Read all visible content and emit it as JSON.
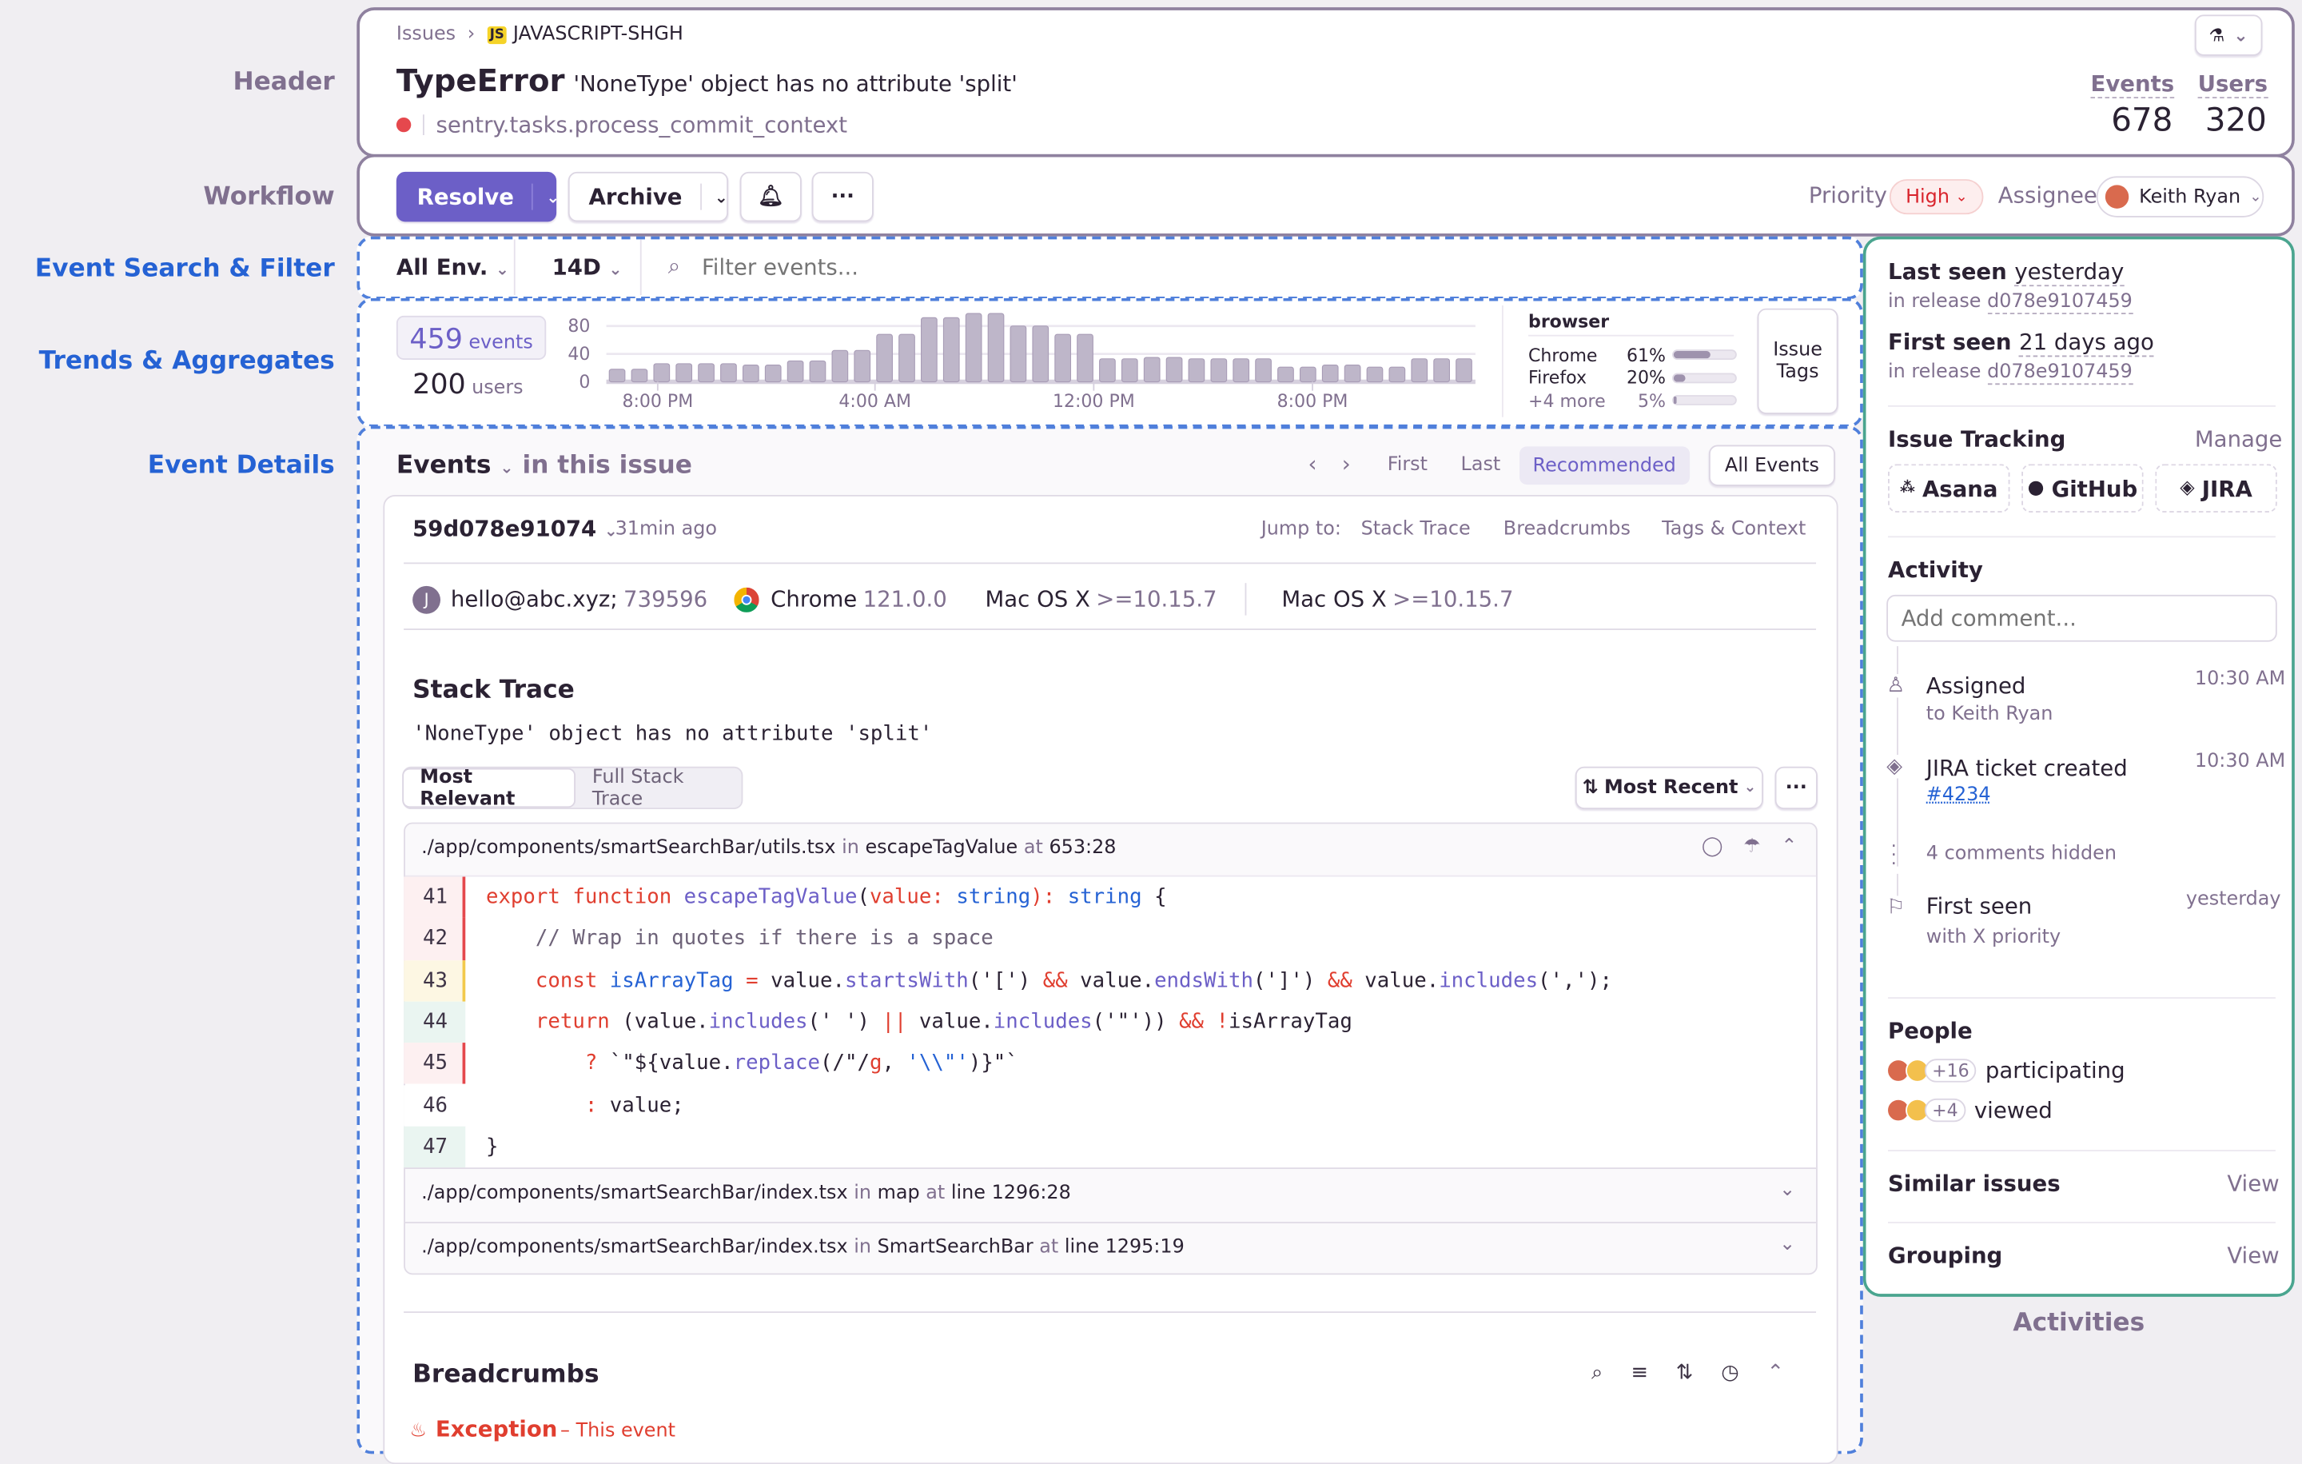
{
  "annotations": {
    "header": "Header",
    "workflow": "Workflow",
    "search": "Event Search & Filter",
    "trends": "Trends & Aggregates",
    "details": "Event Details",
    "activities": "Activities"
  },
  "colors": {
    "accent": "#6c5fc7",
    "annotation_blue": "#2562d4",
    "annotation_gray": "#80708f",
    "sidebar_border": "#4aa58f",
    "error": "#e03e2f"
  },
  "header": {
    "breadcrumb": [
      "Issues",
      "JAVASCRIPT-SHGH"
    ],
    "platform_badge": "JS",
    "error_type": "TypeError",
    "error_message": "'NoneType' object has no attribute 'split'",
    "culprit": "sentry.tasks.process_commit_context",
    "events_label": "Events",
    "events_value": "678",
    "users_label": "Users",
    "users_value": "320",
    "flask_icon": "flask-icon"
  },
  "workflow": {
    "resolve": "Resolve",
    "archive": "Archive",
    "more": "···",
    "priority_label": "Priority",
    "priority_value": "High",
    "assignee_label": "Assignee",
    "assignee_value": "Keith Ryan"
  },
  "filter": {
    "environment": "All Env.",
    "period": "14D",
    "search_placeholder": "Filter events..."
  },
  "trends": {
    "events_count": "459",
    "events_label": "events",
    "users_count": "200",
    "users_label": "users",
    "tag_title": "browser",
    "tags": [
      {
        "name": "Chrome",
        "pct": "61%",
        "value": 61
      },
      {
        "name": "Firefox",
        "pct": "20%",
        "value": 20
      },
      {
        "name": "+4 more",
        "pct": "5%",
        "value": 5
      }
    ],
    "issue_tags_button": "Issue Tags"
  },
  "chart_data": {
    "type": "bar",
    "yticks": [
      "0",
      "40",
      "80"
    ],
    "ylim": [
      0,
      100
    ],
    "xtick_labels": [
      "8:00 PM",
      "4:00 AM",
      "12:00 PM",
      "8:00 PM"
    ],
    "values": [
      18,
      18,
      26,
      26,
      26,
      26,
      24,
      24,
      30,
      30,
      45,
      45,
      68,
      68,
      92,
      92,
      98,
      98,
      80,
      80,
      68,
      68,
      33,
      33,
      35,
      35,
      33,
      33,
      33,
      33,
      21,
      21,
      24,
      24,
      21,
      21,
      33,
      33,
      33
    ],
    "grid": true
  },
  "events": {
    "title": "Events",
    "subtitle": "in this issue",
    "nav": [
      "First",
      "Last",
      "Recommended"
    ],
    "all_events": "All Events",
    "event_id": "59d078e91074",
    "event_age": "31min ago",
    "jump_label": "Jump to:",
    "jump_links": [
      "Stack Trace",
      "Breadcrumbs",
      "Tags & Context"
    ],
    "context": {
      "user_initial": "J",
      "user": "hello@abc.xyz;",
      "user_id": "739596",
      "browser": "Chrome",
      "browser_version": "121.0.0",
      "os1": "Mac OS X",
      "os1_version": ">=10.15.7",
      "os2": "Mac OS X",
      "os2_version": ">=10.15.7"
    }
  },
  "stack": {
    "title": "Stack Trace",
    "message": "'NoneType' object has no attribute 'split'",
    "tabs": [
      "Most Relevant",
      "Full Stack Trace"
    ],
    "sort": "Most Recent",
    "more": "···",
    "frames": [
      {
        "file": "./app/components/smartSearchBar/utils.tsx",
        "in": "in",
        "fn": "escapeTagValue",
        "at": "at",
        "loc": "653:28"
      },
      {
        "file": "./app/components/smartSearchBar/index.tsx",
        "in": "in",
        "fn": "map",
        "at": "at",
        "loc": "line 1296:28"
      },
      {
        "file": "./app/components/smartSearchBar/index.tsx",
        "in": "in",
        "fn": "SmartSearchBar",
        "at": "at",
        "loc": "line 1295:19"
      }
    ],
    "lines": [
      {
        "n": "41",
        "hl": "red",
        "tokens": [
          [
            "export ",
            "kw"
          ],
          [
            "function ",
            "kw"
          ],
          [
            "escapeTagValue",
            "fn"
          ],
          [
            "(",
            "tx"
          ],
          [
            "value: ",
            "kw"
          ],
          [
            "string",
            "ty"
          ],
          [
            "): ",
            "kw"
          ],
          [
            "string",
            "ty"
          ],
          [
            " {",
            "tx"
          ]
        ]
      },
      {
        "n": "42",
        "hl": "red",
        "tokens": [
          [
            "    // Wrap in quotes if there is a space",
            "cm"
          ]
        ]
      },
      {
        "n": "43",
        "hl": "yellow",
        "tokens": [
          [
            "    ",
            "tx"
          ],
          [
            "const ",
            "kw"
          ],
          [
            "isArrayTag",
            "ty"
          ],
          [
            " = ",
            "kw"
          ],
          [
            "value.",
            "tx"
          ],
          [
            "startsWith",
            "fn"
          ],
          [
            "('[') ",
            "tx"
          ],
          [
            "&&",
            "kw"
          ],
          [
            " value.",
            "tx"
          ],
          [
            "endsWith",
            "fn"
          ],
          [
            "(']') ",
            "tx"
          ],
          [
            "&&",
            "kw"
          ],
          [
            " value.",
            "tx"
          ],
          [
            "includes",
            "fn"
          ],
          [
            "(',');",
            "tx"
          ]
        ]
      },
      {
        "n": "44",
        "hl": "green",
        "tokens": [
          [
            "    ",
            "tx"
          ],
          [
            "return ",
            "kw"
          ],
          [
            "(value.",
            "tx"
          ],
          [
            "includes",
            "fn"
          ],
          [
            "(' ') ",
            "tx"
          ],
          [
            "||",
            "kw"
          ],
          [
            " value.",
            "tx"
          ],
          [
            "includes",
            "fn"
          ],
          [
            "('\"')) ",
            "tx"
          ],
          [
            "&&",
            "kw"
          ],
          [
            " !",
            "kw"
          ],
          [
            "isArrayTag",
            "tx"
          ]
        ]
      },
      {
        "n": "45",
        "hl": "red",
        "tokens": [
          [
            "        ",
            "tx"
          ],
          [
            "? ",
            "kw"
          ],
          [
            "`\"${value.",
            "tx"
          ],
          [
            "replace",
            "fn"
          ],
          [
            "(/\"/",
            "tx"
          ],
          [
            "g",
            "kw"
          ],
          [
            ", ",
            "tx"
          ],
          [
            "'\\\\\"'",
            "ty"
          ],
          [
            ")}\"`",
            "tx"
          ]
        ]
      },
      {
        "n": "46",
        "hl": "none",
        "tokens": [
          [
            "        ",
            "tx"
          ],
          [
            ": ",
            "kw"
          ],
          [
            "value;",
            "tx"
          ]
        ]
      },
      {
        "n": "47",
        "hl": "green",
        "tokens": [
          [
            "}",
            "tx"
          ]
        ]
      }
    ]
  },
  "breadcrumbs": {
    "title": "Breadcrumbs",
    "exception": "Exception",
    "this_event": "– This event"
  },
  "sidebar": {
    "last_seen_label": "Last seen",
    "last_seen_value": "yesterday",
    "release_label": "in release",
    "last_release": "d078e9107459",
    "first_seen_label": "First seen",
    "first_seen_value": "21 days ago",
    "first_release": "d078e9107459",
    "issue_tracking": "Issue Tracking",
    "manage": "Manage",
    "integrations": [
      "Asana",
      "GitHub",
      "JIRA"
    ],
    "activity": "Activity",
    "comment_placeholder": "Add comment...",
    "activity_items": [
      {
        "title": "Assigned",
        "detail": "to Keith Ryan",
        "time": "10:30 AM"
      },
      {
        "title": "JIRA ticket created",
        "detail": "#4234",
        "time": "10:30 AM"
      },
      {
        "title": "4 comments hidden"
      },
      {
        "title": "First seen",
        "detail": "with X priority",
        "time": "yesterday"
      }
    ],
    "people": "People",
    "participating_count": "+16",
    "participating": "participating",
    "viewed_count": "+4",
    "viewed": "viewed",
    "similar": "Similar issues",
    "grouping": "Grouping",
    "view": "View"
  }
}
